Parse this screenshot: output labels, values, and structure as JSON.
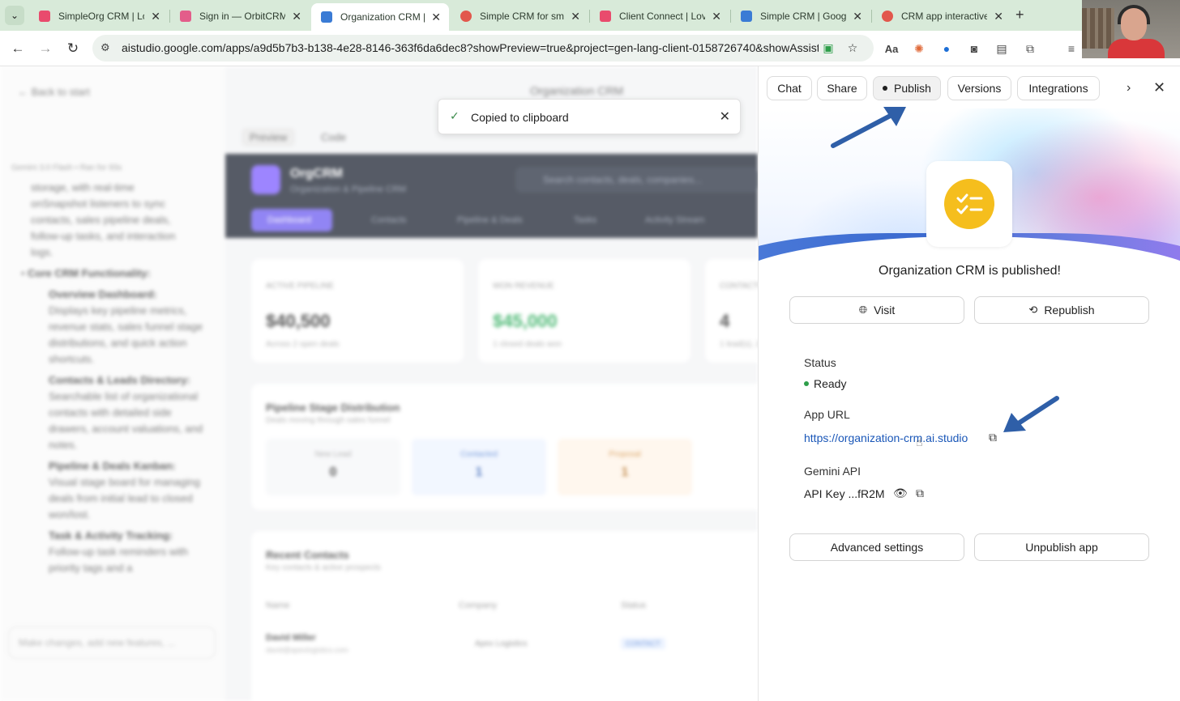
{
  "browser": {
    "tabs": [
      {
        "label": "SimpleOrg CRM | Lov",
        "favicon_color": "#e94b6d"
      },
      {
        "label": "Sign in — OrbitCRM",
        "favicon_color": "#e35d8a"
      },
      {
        "label": "Organization CRM | G",
        "favicon_color": "#3a7bd5",
        "active": true
      },
      {
        "label": "Simple CRM for smal",
        "favicon_color": "#e2574c"
      },
      {
        "label": "Client Connect | Lova",
        "favicon_color": "#e94b6d"
      },
      {
        "label": "Simple CRM | Google",
        "favicon_color": "#3a7bd5"
      },
      {
        "label": "CRM app interactive",
        "favicon_color": "#e2574c"
      }
    ],
    "url": "aistudio.google.com/apps/a9d5b7b3-b138-4e28-8146-363f6da6dec8?showPreview=true&project=gen-lang-client-0158726740&showAssistant..."
  },
  "background": {
    "back_label": "Back to start",
    "center_title": "Organization CRM",
    "preview_tab": "Preview",
    "code_tab": "Code",
    "model_line": "Gemini 3.0 Flash • Ran for 93s",
    "summary_lines": [
      "storage, with real-time",
      "onSnapshot listeners to sync",
      "contacts, sales pipeline deals,",
      "follow-up tasks, and interaction",
      "logs."
    ],
    "core_heading": "Core CRM Functionality:",
    "features": [
      {
        "title": "Overview Dashboard:",
        "desc": "Displays key pipeline metrics, revenue stats, sales funnel stage distributions, and quick action shortcuts."
      },
      {
        "title": "Contacts & Leads Directory:",
        "desc": "Searchable list of organizational contacts with detailed side drawers, account valuations, and notes."
      },
      {
        "title": "Pipeline & Deals Kanban:",
        "desc": "Visual stage board for managing deals from initial lead to closed won/lost."
      },
      {
        "title": "Task & Activity Tracking:",
        "desc": "Follow-up task reminders with priority tags and a"
      }
    ],
    "input_placeholder": "Make changes, add new features, ...",
    "app_name": "OrgCRM",
    "app_sub": "Organization & Pipeline CRM",
    "search_placeholder": "Search contacts, deals, companies...",
    "nav": [
      "Dashboard",
      "Contacts",
      "Pipeline & Deals",
      "Tasks",
      "Activity Stream"
    ],
    "stats": [
      {
        "label": "ACTIVE PIPELINE",
        "value": "$40,500",
        "sub": "Across 2 open deals"
      },
      {
        "label": "WON REVENUE",
        "value": "$45,000",
        "sub": "1 closed deals won"
      },
      {
        "label": "CONTACTS",
        "value": "4",
        "sub": "1 lead(s), 2"
      }
    ],
    "pipeline_title": "Pipeline Stage Distribution",
    "pipeline_sub": "Deals moving through sales funnel",
    "stages": [
      {
        "label": "New Lead",
        "value": "0"
      },
      {
        "label": "Contacted",
        "value": "1"
      },
      {
        "label": "Proposal",
        "value": "1"
      }
    ],
    "recent_title": "Recent Contacts",
    "recent_sub": "Key contacts & active prospects",
    "table_headers": [
      "Name",
      "Company",
      "Status"
    ],
    "row": {
      "name": "David Miller",
      "email": "david@apexlogistics.com",
      "company": "Apex Logistics",
      "status": "CONTACT"
    }
  },
  "toast": {
    "message": "Copied to clipboard"
  },
  "panel": {
    "tabs": [
      "Chat",
      "Share",
      "Publish",
      "Versions",
      "Integrations"
    ],
    "published_title": "Organization CRM is published!",
    "visit_label": "Visit",
    "republish_label": "Republish",
    "status_label": "Status",
    "status_value": "Ready",
    "app_url_label": "App URL",
    "app_url": "https://organization-crm.ai.studio",
    "gemini_api_label": "Gemini API",
    "api_key": "API Key ...fR2M",
    "advanced_label": "Advanced settings",
    "unpublish_label": "Unpublish app",
    "accent_color": "#f5be1d",
    "link_color": "#1a57b8",
    "status_color": "#2e9e4a",
    "arrow_color": "#2f5fa8"
  }
}
